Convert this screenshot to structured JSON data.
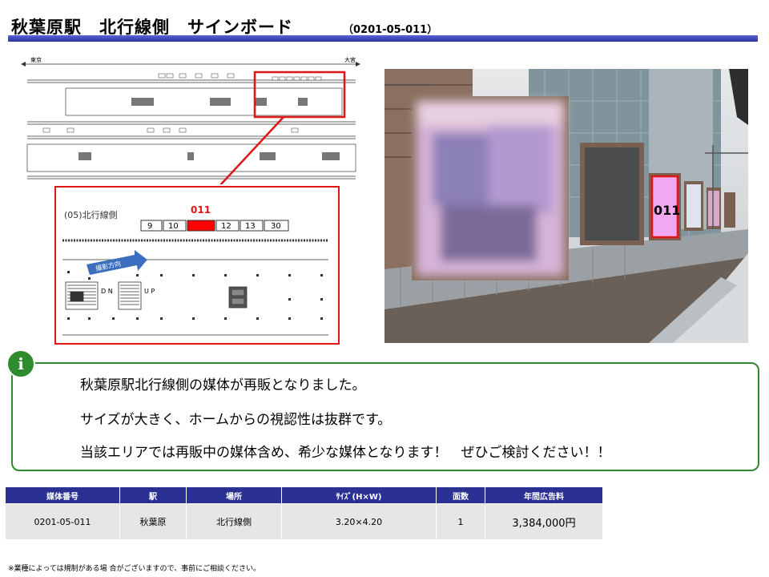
{
  "header": {
    "title": "秋葉原駅　北行線側　サインボード",
    "code": "（0201-05-011）"
  },
  "map": {
    "left_label": "東京",
    "right_label": "大宮"
  },
  "zoom": {
    "platform_label": "(05)北行線側",
    "board_numbers": [
      "9",
      "10",
      "",
      "12",
      "13",
      "30"
    ],
    "highlight_number": "011",
    "direction_label": "撮影方向",
    "down_label": "D N",
    "up_label": "U P",
    "highlight_color": "#e01515"
  },
  "photo": {
    "board_label": "011",
    "highlight_color": "#f2a8f0"
  },
  "info": {
    "icon": "i",
    "lines": [
      "秋葉原駅北行線側の媒体が再販となりました。",
      "サイズが大きく、ホームからの視認性は抜群です。",
      "当該エリアでは再販中の媒体含め、希少な媒体となります！　ぜひご検討ください！！"
    ]
  },
  "table": {
    "headers": [
      "媒体番号",
      "駅",
      "場所",
      "ｻｲｽﾞ(H×W)",
      "面数",
      "年間広告料"
    ],
    "rows": [
      [
        "0201-05-011",
        "秋葉原",
        "北行線側",
        "3.20×4.20",
        "1",
        "3,384,000円"
      ]
    ]
  },
  "footnote": "※業種によっては規制がある場 合がございますので、事前にご相談ください。"
}
